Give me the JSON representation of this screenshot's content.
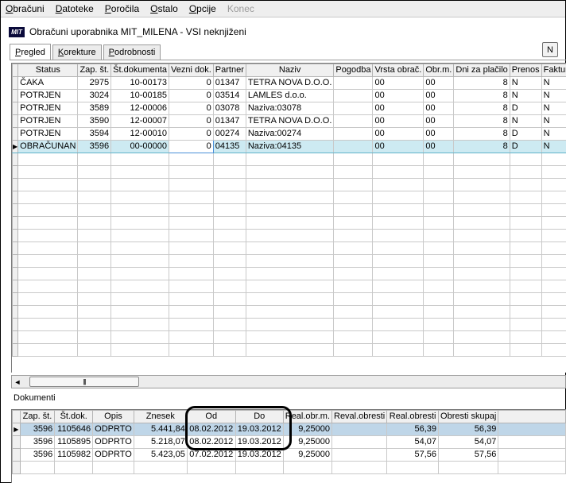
{
  "menu": [
    "Obračuni",
    "Datoteke",
    "Poročila",
    "Ostalo",
    "Opcije",
    "Konec"
  ],
  "window": {
    "logo": "MIT",
    "title": "Obračuni uporabnika MIT_MILENA - VSI neknjiženi"
  },
  "tabs": [
    "Pregled",
    "Korekture",
    "Podrobnosti"
  ],
  "n_button": "N",
  "main_grid": {
    "columns": [
      "Status",
      "Zap. št.",
      "Št.dokumenta",
      "Vezni dok.",
      "Partner",
      "Naziv",
      "Pogodba",
      "Vrsta obrač.",
      "Obr.m.",
      "Dni za plačilo",
      "Prenos",
      "Fakturira"
    ],
    "rows": [
      [
        "ČAKA",
        "2975",
        "10-00173",
        "0",
        "01347",
        "TETRA NOVA D.O.O.",
        "",
        "00",
        "00",
        "8",
        "N",
        "N"
      ],
      [
        "POTRJEN",
        "3024",
        "10-00185",
        "0",
        "03514",
        "LAMLES d.o.o.",
        "",
        "00",
        "00",
        "8",
        "N",
        "N"
      ],
      [
        "POTRJEN",
        "3589",
        "12-00006",
        "0",
        "03078",
        "Naziva:03078",
        "",
        "00",
        "00",
        "8",
        "D",
        "N"
      ],
      [
        "POTRJEN",
        "3590",
        "12-00007",
        "0",
        "01347",
        "TETRA NOVA D.O.O.",
        "",
        "00",
        "00",
        "8",
        "N",
        "N"
      ],
      [
        "POTRJEN",
        "3594",
        "12-00010",
        "0",
        "00274",
        "Naziva:00274",
        "",
        "00",
        "00",
        "8",
        "D",
        "N"
      ],
      [
        "OBRAČUNAN",
        "3596",
        "00-00000",
        "0",
        "04135",
        "Naziva:04135",
        "",
        "00",
        "00",
        "8",
        "D",
        "N"
      ]
    ],
    "selected_row": 5
  },
  "scrollbar": {
    "left_arrow": "◄",
    "thumb_grip": "|||"
  },
  "documents": {
    "label": "Dokumenti",
    "columns": [
      "Zap. št.",
      "Št.dok.",
      "Opis",
      "Znesek",
      "Od",
      "Do",
      "Real.obr.m.",
      "Reval.obresti",
      "Real.obresti",
      "Obresti skupaj"
    ],
    "rows": [
      [
        "3596",
        "1105646",
        "ODPRTO",
        "5.441,84",
        "08.02.2012",
        "19.03.2012",
        "9,25000",
        "",
        "56,39",
        "56,39"
      ],
      [
        "3596",
        "1105895",
        "ODPRTO",
        "5.218,07",
        "08.02.2012",
        "19.03.2012",
        "9,25000",
        "",
        "54,07",
        "54,07"
      ],
      [
        "3596",
        "1105982",
        "ODPRTO",
        "5.423,05",
        "07.02.2012",
        "19.03.2012",
        "9,25000",
        "",
        "57,56",
        "57,56"
      ]
    ],
    "selected_row": 0
  },
  "row_indicator_icon": "▶"
}
